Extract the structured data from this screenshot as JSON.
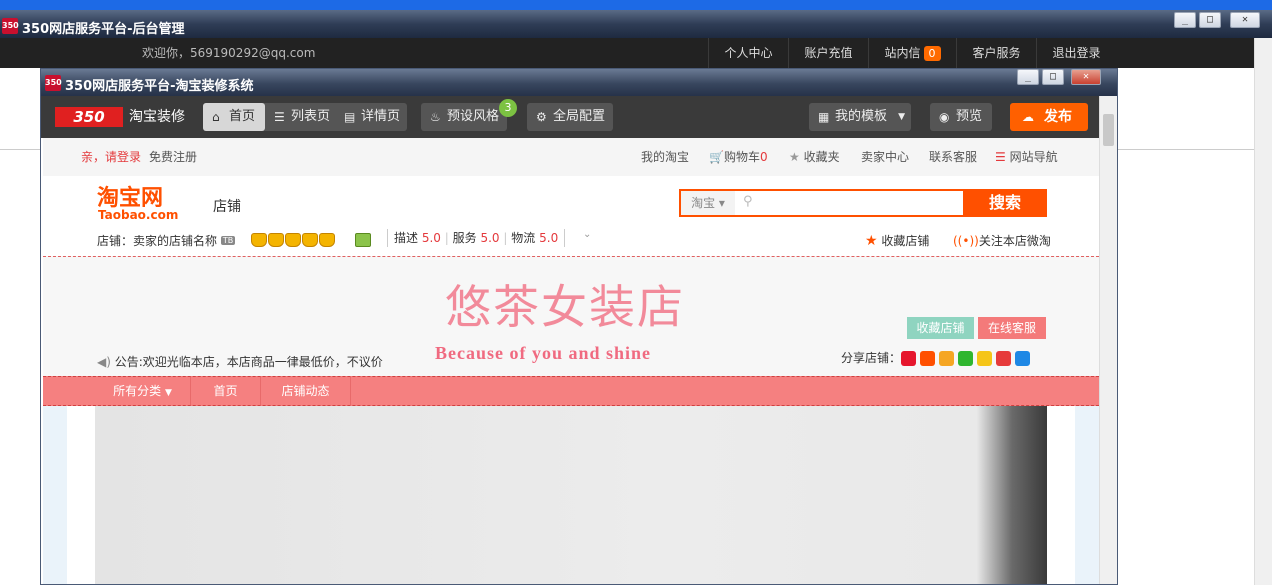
{
  "outer": {
    "app_logo": "350",
    "title": "350网店服务平台-后台管理",
    "welcome": "欢迎你，569190292@qq.com",
    "nav": [
      "个人中心",
      "账户充值",
      "站内信",
      "客户服务",
      "退出登录"
    ],
    "messages_count": "0"
  },
  "inner": {
    "app_logo": "350",
    "title": "350网店服务平台-淘宝装修系统",
    "brand_logo": "350",
    "brand": "淘宝装修",
    "tabs": [
      "首页",
      "列表页",
      "详情页"
    ],
    "preset_style": "预设风格",
    "preset_badge": "3",
    "global_config": "全局配置",
    "my_templates": "我的模板",
    "preview": "预览",
    "publish": "发布"
  },
  "taobao": {
    "greeting": "亲，请登录",
    "register": "免费注册",
    "top_links": [
      "我的淘宝",
      "购物车",
      "收藏夹",
      "卖家中心",
      "联系客服",
      "网站导航"
    ],
    "cart_count": "0",
    "logo_cn": "淘宝网",
    "logo_en": "Taobao.com",
    "shop_label": "店铺",
    "search_scope": "淘宝",
    "search_button": "搜索",
    "shop_name_label": "店铺：",
    "shop_name": "卖家的店铺名称",
    "tb_tag": "TB",
    "ratings": [
      {
        "label": "描述",
        "value": "5.0"
      },
      {
        "label": "服务",
        "value": "5.0"
      },
      {
        "label": "物流",
        "value": "5.0"
      }
    ],
    "fav_shop": "收藏店铺",
    "follow_weitao": "关注本店微淘"
  },
  "banner": {
    "shop_title": "悠茶女装店",
    "subtitle": "Because of you and shine",
    "notice": "公告:欢迎光临本店，本店商品一律最低价，不议价",
    "fav_button": "收藏店铺",
    "service_button": "在线客服",
    "share_label": "分享店铺：",
    "share_icons": [
      {
        "name": "weibo",
        "color": "#e6162d"
      },
      {
        "name": "taobao",
        "color": "#ff5000"
      },
      {
        "name": "sohu",
        "color": "#f5a623"
      },
      {
        "name": "douban",
        "color": "#2fb62f"
      },
      {
        "name": "qzone",
        "color": "#f5c518"
      },
      {
        "name": "kaixin",
        "color": "#e63b3b"
      },
      {
        "name": "renren",
        "color": "#1e88e5"
      }
    ]
  },
  "shop_nav": [
    "所有分类",
    "首页",
    "店铺动态"
  ]
}
